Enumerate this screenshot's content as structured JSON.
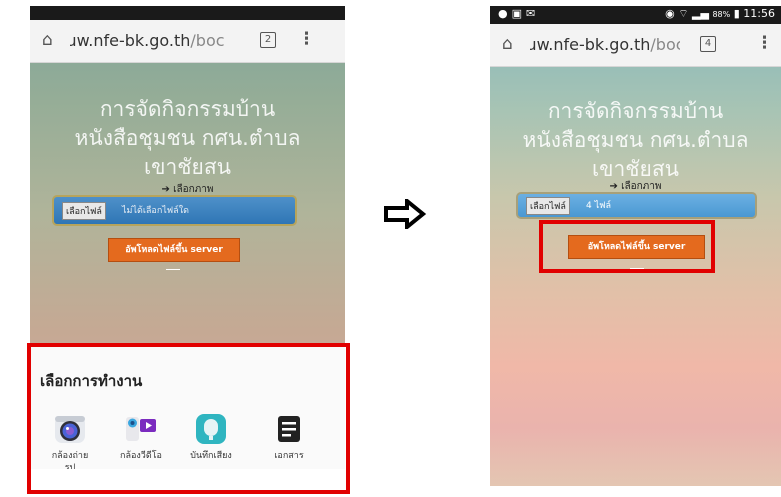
{
  "left_phone": {
    "url_domain": "ɹw.nfe-bk.go.th",
    "url_path": "/boc",
    "tabs_count": "2",
    "page_title": [
      "การจัดกิจกรรมบ้าน",
      "หนังสือชุมชน กศน.ตำบล",
      "เขาชัยสน"
    ],
    "link_text": "➔ เลือกภาพ",
    "file_button": "เลือกไฟล์",
    "file_status": "ไม่ได้เลือกไฟล์ใด",
    "upload_button": "อัพโหลดไฟล์ขึ้น server",
    "sheet_title": "เลือกการทำงาน",
    "apps": [
      {
        "label": "กล้องถ่าย\nรูป",
        "icon": "camera-icon"
      },
      {
        "label": "กล้องวีดีโอ",
        "icon": "video-camera-icon"
      },
      {
        "label": "บันทึกเสียง",
        "icon": "voice-recorder-icon"
      },
      {
        "label": "เอกสาร",
        "icon": "documents-icon"
      }
    ]
  },
  "right_phone": {
    "status_time": "11:56",
    "status_battery": "88%",
    "url_domain": "ɹw.nfe-bk.go.th",
    "url_path": "/boc",
    "tabs_count": "4",
    "page_title": [
      "การจัดกิจกรรมบ้าน",
      "หนังสือชุมชน กศน.ตำบล",
      "เขาชัยสน"
    ],
    "link_text": "➔ เลือกภาพ",
    "file_button": "เลือกไฟล์",
    "file_status": "4 ไฟล์",
    "upload_button": "อัพโหลดไฟล์ขึ้น server"
  },
  "colors": {
    "highlight": "#e10000",
    "upload": "#e46a1e",
    "file_picker": "#3a82c0"
  },
  "arrow_icon": "right-arrow-outline-icon"
}
